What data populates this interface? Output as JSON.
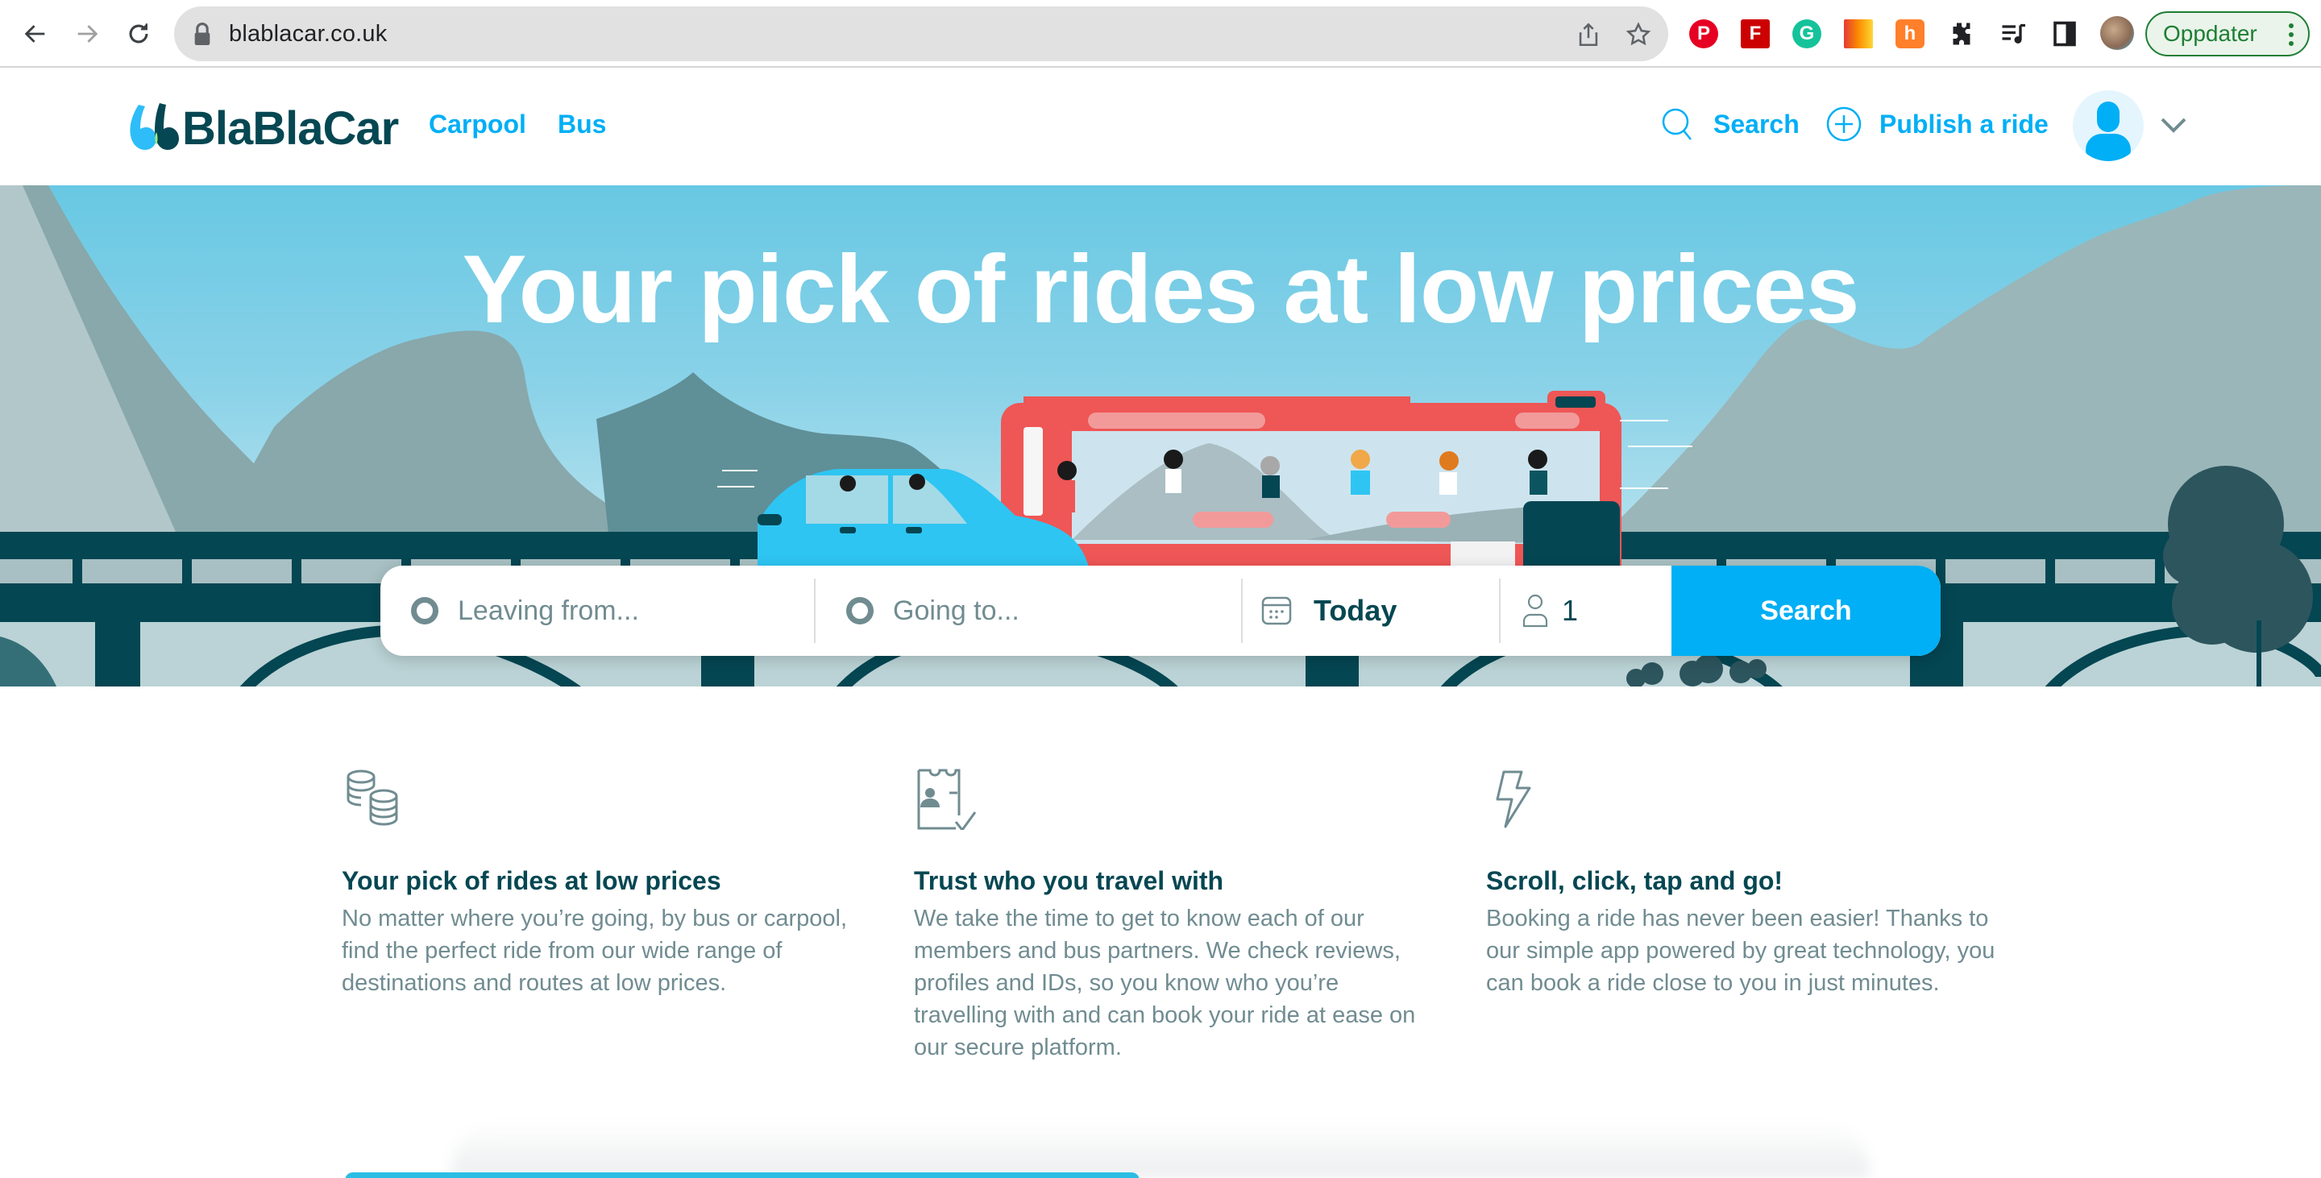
{
  "browser": {
    "url": "blablacar.co.uk",
    "update_label": "Oppdater",
    "extensions": [
      "pinterest-icon",
      "flipboard-icon",
      "grammarly-icon",
      "extension-m-icon",
      "honey-icon",
      "puzzle-extensions-icon",
      "media-queue-icon",
      "side-panel-icon"
    ]
  },
  "header": {
    "brand": "BlaBlaCar",
    "nav": [
      {
        "label": "Carpool"
      },
      {
        "label": "Bus"
      }
    ],
    "search_label": "Search",
    "publish_label": "Publish a ride"
  },
  "hero": {
    "title": "Your pick of rides at low prices"
  },
  "search_form": {
    "leaving_placeholder": "Leaving from...",
    "going_placeholder": "Going to...",
    "date_value": "Today",
    "passengers_value": "1",
    "submit_label": "Search"
  },
  "features": [
    {
      "icon": "coins-icon",
      "title": "Your pick of rides at low prices",
      "text": "No matter where you’re going, by bus or carpool, find the perfect ride from our wide range of destinations and routes at low prices."
    },
    {
      "icon": "verified-id-icon",
      "title": "Trust who you travel with",
      "text": "We take the time to get to know each of our members and bus partners. We check reviews, profiles and IDs, so you know who you’re travelling with and can book your ride at ease on our secure platform."
    },
    {
      "icon": "lightning-icon",
      "title": "Scroll, click, tap and go!",
      "text": "Booking a ride has never been easier! Thanks to our simple app powered by great technology, you can book a ride close to you in just minutes."
    }
  ],
  "colors": {
    "brand_blue": "#00aff5",
    "brand_dark": "#054752",
    "text_muted": "#708c91",
    "bus_red": "#ef5656",
    "car_blue": "#2ec5f2"
  }
}
